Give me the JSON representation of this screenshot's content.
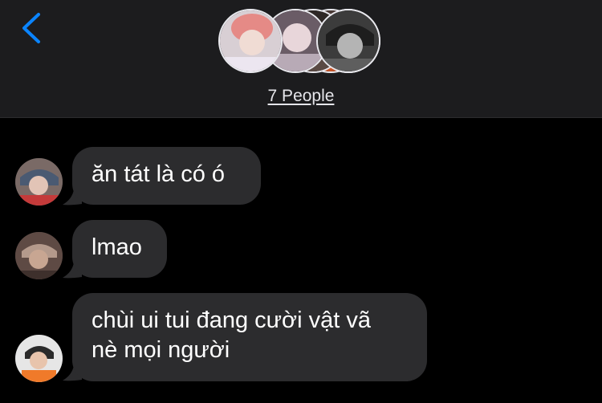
{
  "header": {
    "back_icon": "chevron-left-icon",
    "group_label": "7 People",
    "accent_color": "#0a84ff"
  },
  "messages": [
    {
      "text": "ăn tát là có ó"
    },
    {
      "text": "lmao"
    },
    {
      "text": "chùi ui tui đang cười vật vã\nnè mọi người"
    }
  ],
  "colors": {
    "background": "#000000",
    "header_bg": "#1c1c1e",
    "bubble_bg": "#2c2c2e",
    "text": "#ffffff"
  }
}
